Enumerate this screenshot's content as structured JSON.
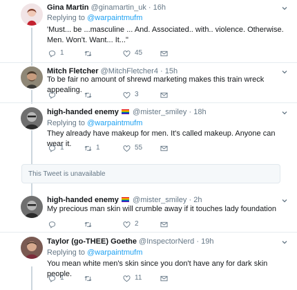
{
  "replying_to_prefix": "Replying to",
  "tweets": [
    {
      "name": "Gina Martin",
      "handle": "@ginamartin_uk",
      "time": "16h",
      "reply_to": "@warpaintmufm",
      "text": "'Must... be ...masculine ... And. Associated.. with.. violence. Otherwise. Men. Won't. Want... It...\"",
      "replies": "1",
      "retweets": "",
      "likes": "45"
    },
    {
      "name": "Mitch Fletcher",
      "handle": "@MitchFletcher4",
      "time": "15h",
      "text": "To be fair no amount of shrewd marketing makes this train wreck appealing.",
      "replies": "",
      "retweets": "",
      "likes": "3"
    },
    {
      "name": "high-handed enemy",
      "handle": "@mister_smiley",
      "time": "18h",
      "reply_to": "@warpaintmufm",
      "text": "They already have makeup for men. It's called makeup. Anyone can wear it.",
      "replies": "1",
      "retweets": "1",
      "likes": "55"
    },
    {
      "name": "high-handed enemy",
      "handle": "@mister_smiley",
      "time": "2h",
      "text": "My precious man skin will crumble away if it touches lady foundation",
      "replies": "",
      "retweets": "",
      "likes": "2"
    },
    {
      "name": "Taylor (go-THEE) Goethe",
      "handle": "@InspectorNerd",
      "time": "19h",
      "reply_to": "@warpaintmufm",
      "text": "You mean white men's skin since you don't have any for dark skin people.",
      "replies": "1",
      "retweets": "",
      "likes": "11"
    }
  ],
  "unavailable_text": "This Tweet is unavailable",
  "colors": {
    "accent": "#1da1f2",
    "muted": "#657786",
    "thread_line": "#ccd6dd"
  }
}
